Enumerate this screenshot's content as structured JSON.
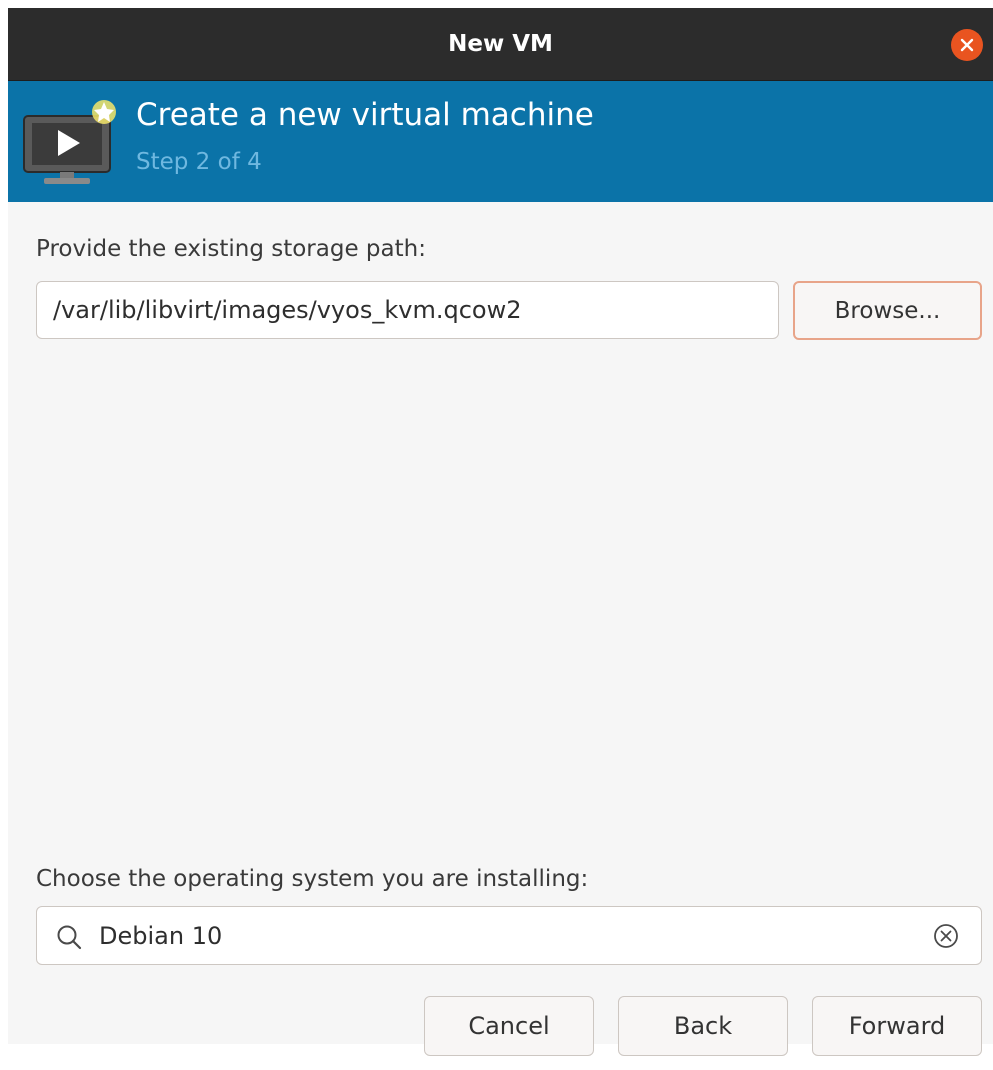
{
  "window": {
    "title": "New VM",
    "close_icon": "close-icon"
  },
  "banner": {
    "icon": "vm-monitor-icon",
    "title": "Create a new virtual machine",
    "step": "Step 2 of 4",
    "colors": {
      "background": "#0b73a8",
      "step_text": "#6fb8e0"
    }
  },
  "storage": {
    "label": "Provide the existing storage path:",
    "path_value": "/var/lib/libvirt/images/vyos_kvm.qcow2",
    "browse_label": "Browse..."
  },
  "os": {
    "label": "Choose the operating system you are installing:",
    "search_icon": "search-icon",
    "search_value": "Debian 10",
    "clear_icon": "clear-icon"
  },
  "footer": {
    "cancel_label": "Cancel",
    "back_label": "Back",
    "forward_label": "Forward"
  },
  "colors": {
    "accent": "#e95420",
    "titlebar": "#2c2c2c"
  }
}
